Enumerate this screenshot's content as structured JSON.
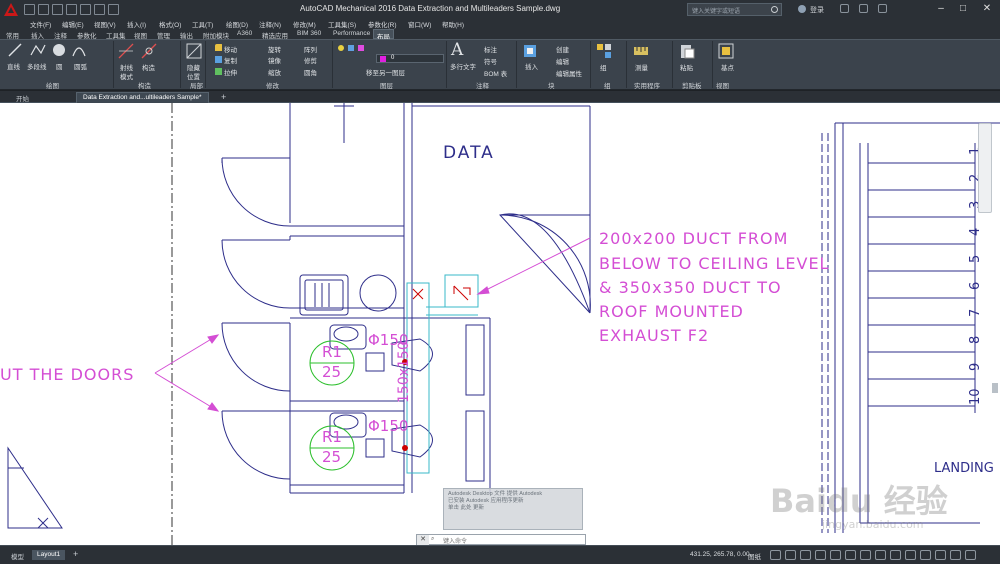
{
  "window": {
    "title": "AutoCAD Mechanical 2016     Data Extraction and Multileaders Sample.dwg",
    "search_placeholder": "键入关键字或短语",
    "login": "登录"
  },
  "menu": [
    "文件(F)",
    "编辑(E)",
    "视图(V)",
    "插入(I)",
    "格式(O)",
    "工具(T)",
    "绘图(D)",
    "注释(N)",
    "修改(M)",
    "工具集(S)",
    "参数化(R)",
    "窗口(W)",
    "帮助(H)"
  ],
  "ribbon_tabs": [
    "常用",
    "插入",
    "注释",
    "参数化",
    "工具集",
    "视图",
    "管理",
    "输出",
    "附加模块",
    "A360",
    "精选应用",
    "BIM 360",
    "Performance",
    "布局"
  ],
  "active_ribbon_tab": "布局",
  "ribbon": {
    "draw": {
      "line": "直线",
      "polyline": "多段线",
      "circle": "圆",
      "arc": "圆弧",
      "label": "绘图"
    },
    "construct": {
      "ray": "射线",
      "mode": "模式",
      "construct": "构造",
      "label": "构造"
    },
    "detail": {
      "hide": "隐藏",
      "position": "位置",
      "label": "局部"
    },
    "modify": {
      "move": "移动",
      "rotate": "旋转",
      "copy": "复制",
      "mirror": "镜像",
      "stretch": "拉伸",
      "scale": "缩放",
      "trim": "修剪",
      "fillet": "圆角",
      "array": "阵列",
      "label": "修改"
    },
    "layers": {
      "current": "0",
      "move_to": "移至另一图层",
      "label": "图层"
    },
    "annotation": {
      "multiline_text": "多行文字",
      "dimension": "标注",
      "symbol": "符号",
      "bom": "BOM 表",
      "label": "注释"
    },
    "block": {
      "insert": "插入",
      "create": "创建",
      "edit": "编辑",
      "edit_attr": "编辑属性",
      "label": "块"
    },
    "groups": {
      "group": "组",
      "label": "组"
    },
    "utilities": {
      "measure": "测量",
      "label": "实用程序"
    },
    "clipboard": {
      "paste": "粘贴",
      "label": "剪贴板"
    },
    "view": {
      "base": "基点",
      "label": "视图"
    }
  },
  "doc_tabs": [
    "开始",
    "Data Extraction and...ultileaders Sample*"
  ],
  "drawing": {
    "room_label": "DATA",
    "leader_note": [
      "200x200 DUCT FROM",
      "BELOW TO CEILING LEVEL",
      "& 350x350 DUCT TO",
      "ROOF MOUNTED",
      "EXHAUST F2"
    ],
    "left_note": "UT THE DOORS",
    "room_tag_1": [
      "R1",
      "25"
    ],
    "room_tag_2": [
      "R1",
      "25"
    ],
    "diameter_1": "Φ150",
    "diameter_2": "Φ150",
    "vertical_dim": "150x150",
    "stair_numbers": [
      "1",
      "2",
      "3",
      "4",
      "5",
      "6",
      "7",
      "8",
      "9",
      "10"
    ],
    "landing": "LANDING"
  },
  "command_line": {
    "prompt": "键入命令",
    "history": [
      "Autodesk Desktop 文件 提供 Autodesk",
      "已安装 Autodesk 应用程序更新",
      "单击 此处 更新"
    ]
  },
  "status": {
    "layout_tabs": [
      "模型",
      "Layout1"
    ],
    "active_layout": "Layout1",
    "coordinates": "431.25, 265.78, 0.00",
    "paper": "图纸"
  },
  "watermark": {
    "brand": "Baidu 经验",
    "url": "jingyan.baidu.com"
  },
  "colors": {
    "accent": "#cc0000",
    "annotation": "#d44ed4",
    "walls": "#2e2e8a",
    "duct": "#3ab8c8",
    "tag": "#2bbf2b"
  }
}
